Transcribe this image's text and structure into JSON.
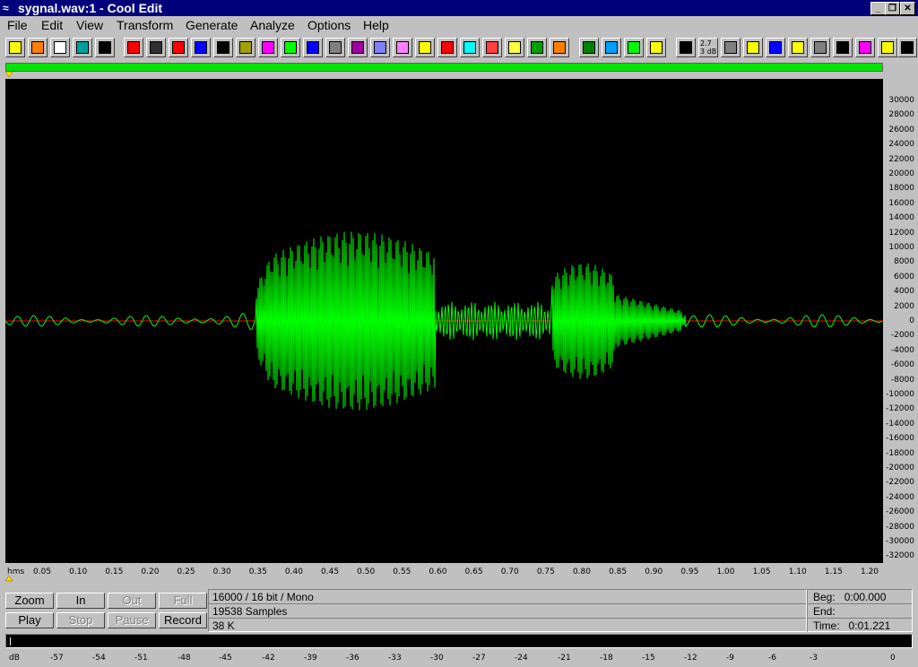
{
  "window": {
    "title": "sygnal.wav:1 - Cool Edit",
    "minimize": "_",
    "restore": "❐",
    "close": "✕"
  },
  "menu": [
    "File",
    "Edit",
    "View",
    "Transform",
    "Generate",
    "Analyze",
    "Options",
    "Help"
  ],
  "toolbar_text": {
    "db_button": "2.7\n3 dB"
  },
  "y_axis": {
    "labels": [
      "30000",
      "28000",
      "26000",
      "24000",
      "22000",
      "20000",
      "18000",
      "16000",
      "14000",
      "12000",
      "10000",
      "8000",
      "6000",
      "4000",
      "2000",
      "0",
      "-2000",
      "-4000",
      "-6000",
      "-8000",
      "-10000",
      "-12000",
      "-14000",
      "-16000",
      "-18000",
      "-20000",
      "-22000",
      "-24000",
      "-26000",
      "-28000",
      "-30000",
      "-32000"
    ]
  },
  "x_axis": {
    "unit": "hms",
    "labels": [
      "0.05",
      "0.10",
      "0.15",
      "0.20",
      "0.25",
      "0.30",
      "0.35",
      "0.40",
      "0.45",
      "0.50",
      "0.55",
      "0.60",
      "0.65",
      "0.70",
      "0.75",
      "0.80",
      "0.85",
      "0.90",
      "0.95",
      "1.00",
      "1.05",
      "1.10",
      "1.15",
      "1.20"
    ]
  },
  "buttons": {
    "zoom": "Zoom",
    "in": "In",
    "out": "Out",
    "full": "Full",
    "play": "Play",
    "stop": "Stop",
    "pause": "Pause",
    "record": "Record"
  },
  "info": {
    "format": "16000 / 16 bit / Mono",
    "samples": "19538 Samples",
    "size": "38 K"
  },
  "time": {
    "beg": "Beg:   0:00.000",
    "end": "End:",
    "time": "Time:   0:01.221"
  },
  "meter": {
    "labels": [
      "dB",
      "-57",
      "-54",
      "-51",
      "-48",
      "-45",
      "-42",
      "-39",
      "-36",
      "-33",
      "-30",
      "-27",
      "-24",
      "-21",
      "-18",
      "-15",
      "-12",
      "-9",
      "-6",
      "-3",
      "0"
    ]
  },
  "colors": {
    "waveform": "#00ff00",
    "background": "#000000",
    "centerline": "#ff0000",
    "titlebar": "#00007b"
  }
}
